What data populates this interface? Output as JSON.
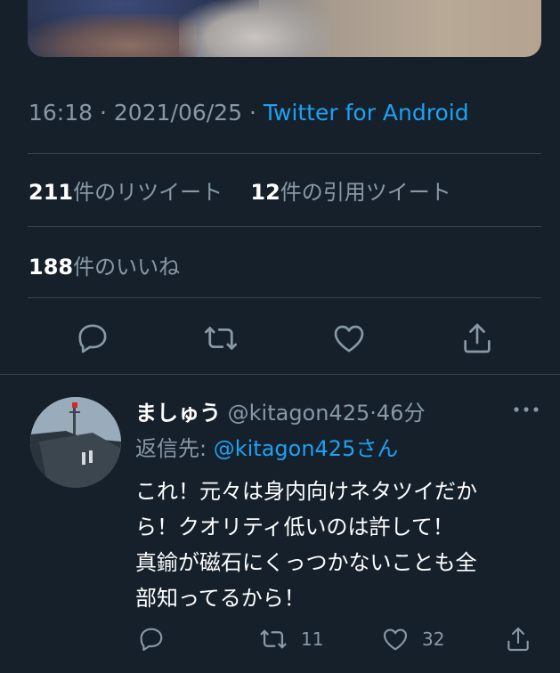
{
  "tweet": {
    "time": "16:18",
    "date": "2021/06/25",
    "source": "Twitter for Android",
    "retweets_count": "211",
    "retweets_label": "件のリツイート",
    "quotes_count": "12",
    "quotes_label": "件の引用ツイート",
    "likes_count": "188",
    "likes_label": "件のいいね"
  },
  "reply": {
    "display_name": "ましゅう",
    "handle": "@kitagon425",
    "elapsed": "46分",
    "reply_to_prefix": "返信先: ",
    "reply_to_handle": "@kitagon425さん",
    "lines": [
      "これ！元々は身内向けネタツイだか",
      "ら！クオリティ低いのは許して！",
      "真鍮が磁石にくっつかないことも全",
      "部知ってるから！"
    ],
    "retweet_count": "11",
    "like_count": "32"
  },
  "icons": {
    "reply": "reply-icon",
    "retweet": "retweet-icon",
    "like": "heart-icon",
    "share": "share-icon",
    "more": "more-icon"
  },
  "colors": {
    "background": "#15202b",
    "text": "#ffffff",
    "secondary": "#8899a6",
    "accent": "#1da1f2",
    "divider": "#38444d"
  }
}
